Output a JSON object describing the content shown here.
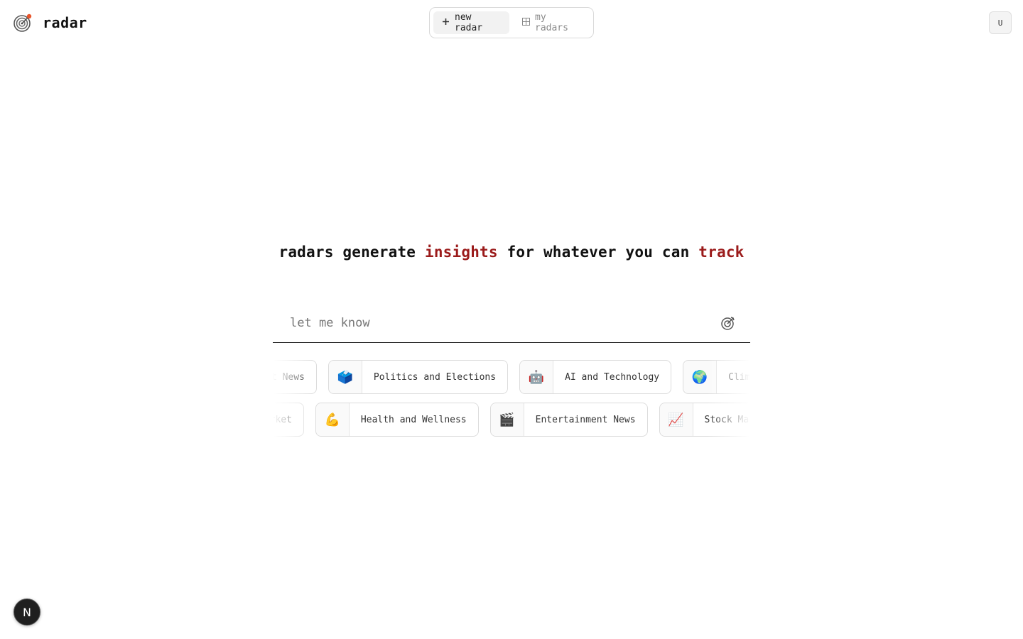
{
  "header": {
    "logo_text": "radar",
    "logo_icon": "radar-icon",
    "nav": [
      {
        "label": "new radar",
        "icon": "plus-icon",
        "active": true
      },
      {
        "label": "my radars",
        "icon": "grid-icon",
        "active": false
      }
    ],
    "user_initial": "U"
  },
  "hero": {
    "headline_parts": [
      "radars generate ",
      "insights",
      " for whatever you can ",
      "track"
    ],
    "accent_color": "#9b1b1b"
  },
  "search": {
    "placeholder": "let me know",
    "submit_icon": "target-icon"
  },
  "suggestions": {
    "row1": [
      {
        "emoji": "🎭",
        "label": "Entertainment News"
      },
      {
        "emoji": "🗳️",
        "label": "Politics and Elections"
      },
      {
        "emoji": "🤖",
        "label": "AI and Technology"
      },
      {
        "emoji": "🌍",
        "label": "Climate Change"
      }
    ],
    "row2": [
      {
        "emoji": "📈",
        "label": "Stock Market"
      },
      {
        "emoji": "💪",
        "label": "Health and Wellness"
      },
      {
        "emoji": "🎬",
        "label": "Entertainment News"
      },
      {
        "emoji": "📈",
        "label": "Stock Market"
      }
    ]
  },
  "floating_badge": {
    "label": "N"
  }
}
